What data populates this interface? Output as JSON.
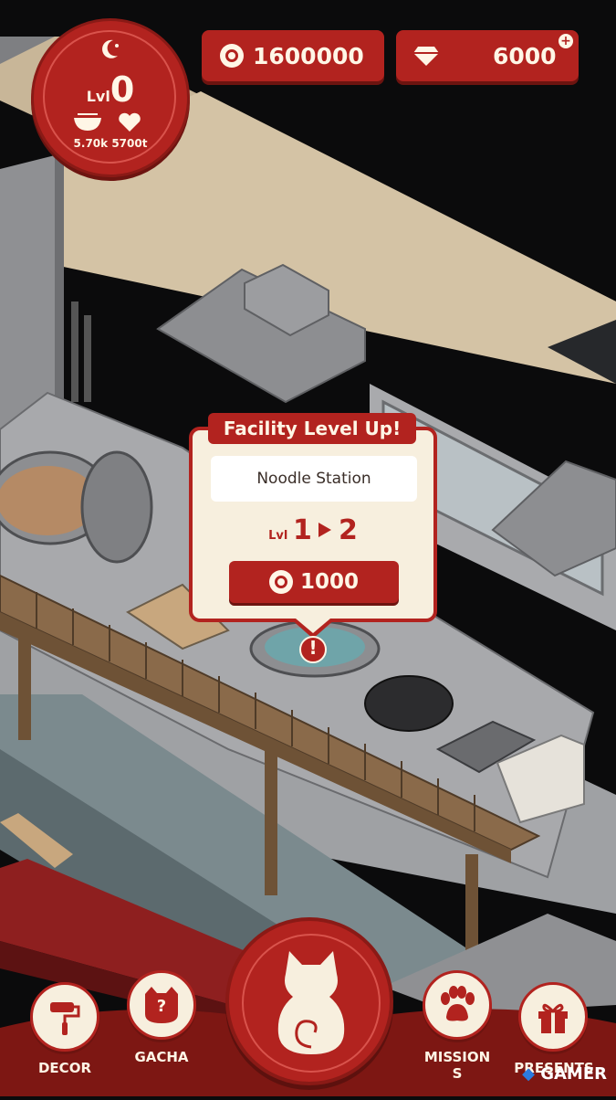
{
  "hud": {
    "level_prefix": "Lvl",
    "level_value": "0",
    "stats_text": "5.70k 5700t",
    "coins": "1600000",
    "gems": "6000",
    "plus_symbol": "+"
  },
  "popup": {
    "title": "Facility Level Up!",
    "facility_name": "Noodle Station",
    "level_prefix": "Lvl",
    "level_from": "1",
    "level_to": "2",
    "cost": "1000",
    "alert_symbol": "!"
  },
  "nav": {
    "decor": "DECOR",
    "gacha": "GACHA",
    "missions_line1": "MISSION",
    "missions_line2": "S",
    "presents": "PRESENTS",
    "gacha_symbol": "?"
  },
  "watermark": "GAMER",
  "colors": {
    "primary_red": "#b2231f",
    "cream": "#f7efde"
  }
}
